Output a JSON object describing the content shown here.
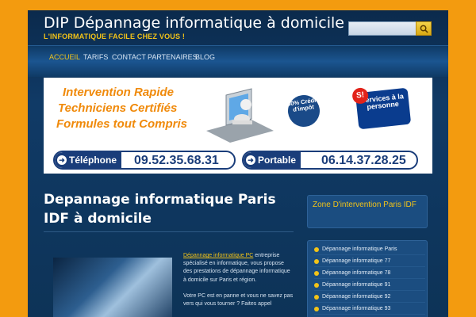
{
  "header": {
    "title": "DIP Dépannage informatique à domicile",
    "tagline": "L'INFORMATIQUE FACILE CHEZ VOUS !",
    "search_placeholder": ""
  },
  "nav": {
    "items": [
      {
        "label": "ACCUEIL",
        "active": true
      },
      {
        "label": "TARIFS",
        "active": false
      },
      {
        "label": "CONTACT",
        "active": false
      },
      {
        "label": "PARTENAIRES",
        "active": false
      },
      {
        "label": "BLOG",
        "active": false
      }
    ]
  },
  "banner": {
    "lines": [
      "Intervention Rapide",
      "Techniciens Certifiés",
      "Formules tout Compris"
    ],
    "credit_badge": "50% Crédit d'impôt",
    "services_badge": "Services à la personne",
    "services_mark": "S!",
    "phone_label": "Téléphone",
    "phone_number": "09.52.35.68.31",
    "mobile_label": "Portable",
    "mobile_number": "06.14.37.28.25"
  },
  "main": {
    "heading": "Depannage informatique Paris IDF à domicile",
    "link_text": "Dépannage informatique PC",
    "paragraph1": " entreprise spécialisé en informatique, vous propose des prestations de dépannage informatique à domicile sur Paris et région.",
    "paragraph2": "Votre PC est en panne et vous ne savez pas vers qui vous tourner ? Faites appel"
  },
  "sidebar": {
    "widget_title": "Zone D'intervention Paris IDF",
    "items": [
      "Dépannage informatique Paris",
      "Dépannage informatique 77",
      "Dépannage informatique 78",
      "Dépannage informatique 91",
      "Dépannage informatique 92",
      "Dépannage informatique 93"
    ]
  },
  "colors": {
    "background": "#f39b0f",
    "accent": "#f2c318",
    "page": "#0d3357"
  }
}
